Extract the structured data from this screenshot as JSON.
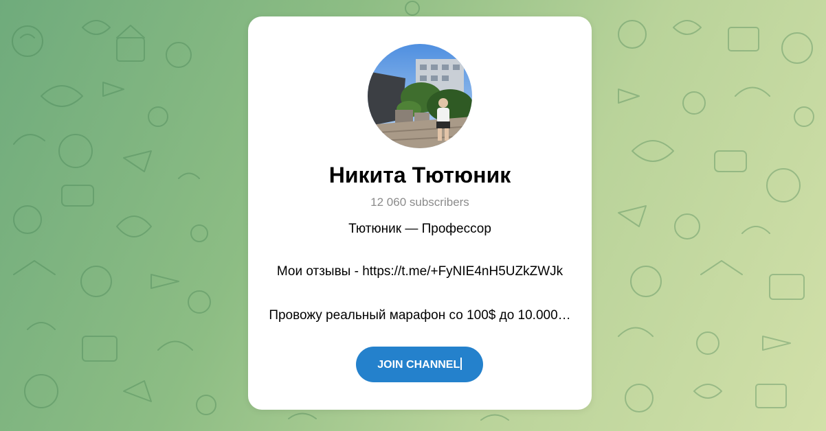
{
  "channel": {
    "name": "Никита Тютюник",
    "subscribers": "12 060 subscribers",
    "description_lines": [
      "Тютюник — Профессор",
      "Мои отзывы - https://t.me/+FyNIE4nH5UZkZWJk",
      "Провожу реальный марафон со 100$ до 10.000…"
    ]
  },
  "join_button": {
    "label": "JOIN CHANNEL"
  },
  "colors": {
    "accent": "#2481cc",
    "card": "#ffffff",
    "muted_text": "#8b8b8b"
  },
  "icons": [
    "telegram-pattern-doodles",
    "channel-avatar-photo"
  ]
}
